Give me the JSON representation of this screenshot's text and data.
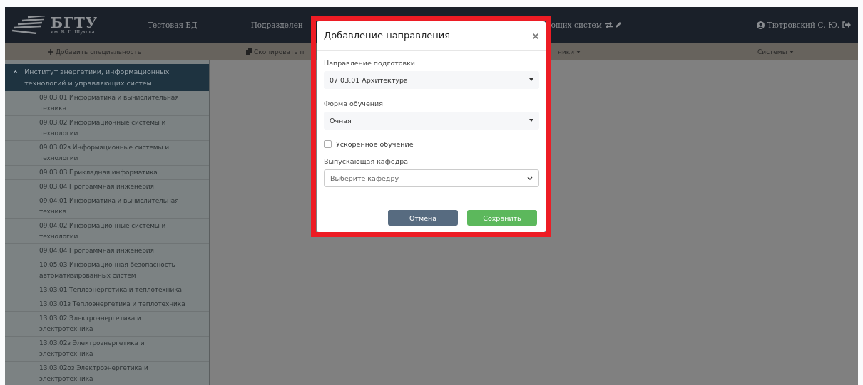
{
  "navbar": {
    "logo": {
      "title": "БГТУ",
      "subtitle": "им. В. Г. Шухова"
    },
    "items": [
      "Тестовая БД",
      "Подразделен",
      "ющих систем"
    ],
    "user": "Тютровский С. Ю."
  },
  "toolbar": [
    {
      "label": "Добавить специальность",
      "kind": "add"
    },
    {
      "label": "Скопировать п",
      "kind": "copy"
    },
    {
      "label": "ники",
      "kind": "dropdown"
    },
    {
      "label": "Системы",
      "kind": "dropdown"
    }
  ],
  "sidebar": {
    "group": {
      "title": "Институт энергетики, информационных технологий и управляющих систем",
      "expanded": true,
      "children": [
        {
          "label": "09.03.01 Информатика и вычислительная техника"
        },
        {
          "label": "09.03.02 Информационные системы и технологии"
        },
        {
          "label": "09.03.02з Информационные системы и технологии"
        },
        {
          "label": "09.03.03 Прикладная информатика"
        },
        {
          "label": "09.03.04 Программная инженерия"
        },
        {
          "label": "09.04.01 Информатика и вычислительная техника"
        },
        {
          "label": "09.04.02 Информационные системы и технологии"
        },
        {
          "label": "09.04.04 Программная инженерия"
        },
        {
          "label": "10.05.03 Информационная безопасность автоматизированных систем"
        },
        {
          "label": "13.03.01 Теплоэнергетика и теплотехника"
        },
        {
          "label": "13.03.01з Теплоэнергетика и теплотехника"
        },
        {
          "label": "13.03.02 Электроэнергетика и электротехника"
        },
        {
          "label": "13.03.02з Электроэнергетика и электротехника"
        },
        {
          "label": "13.03.02оз Электроэнергетика и электротехника"
        }
      ]
    }
  },
  "modal": {
    "title": "Добавление направления",
    "highlighted": true,
    "fields": [
      {
        "kind": "select",
        "label": "Направление подготовки",
        "value": "07.03.01 Архитектура"
      },
      {
        "kind": "select",
        "label": "Форма обучения",
        "value": "Очная"
      },
      {
        "kind": "checkbox",
        "label": "Ускоренное обучение",
        "checked": false
      },
      {
        "kind": "native-select",
        "label": "Выпускающая кафедра",
        "placeholder": "Выберите кафедру"
      }
    ],
    "buttons": [
      {
        "label": "Отмена",
        "kind": "secondary"
      },
      {
        "label": "Сохранить",
        "kind": "primary"
      }
    ]
  }
}
